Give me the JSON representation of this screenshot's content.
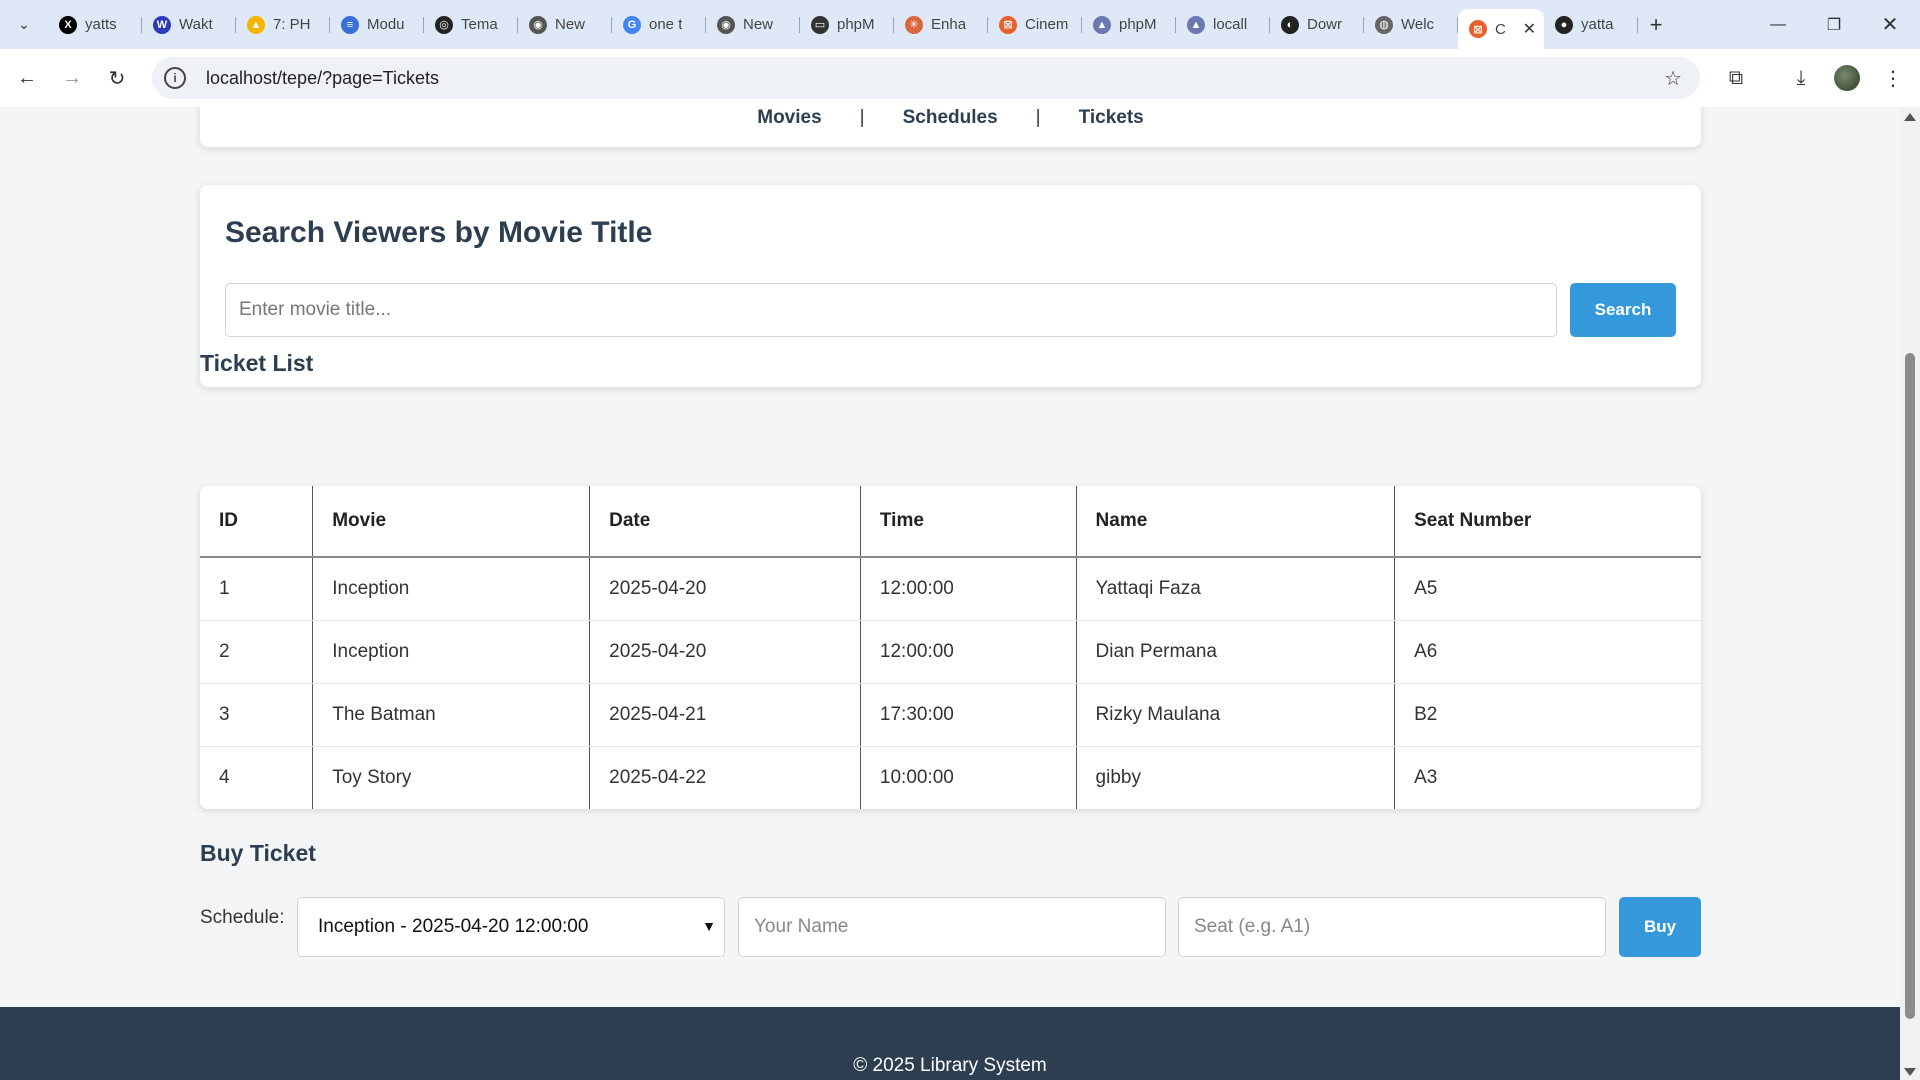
{
  "browser": {
    "tabs": [
      {
        "label": "yatts",
        "icon": "x-logo-icon",
        "color": "#000000",
        "glyph": "X"
      },
      {
        "label": "Wakt",
        "icon": "wakatime-icon",
        "color": "#2b3bb8",
        "glyph": "W"
      },
      {
        "label": "7: PH",
        "icon": "google-drive-icon",
        "color": "#f4b400",
        "glyph": "▲"
      },
      {
        "label": "Modu",
        "icon": "google-docs-icon",
        "color": "#3b6fd8",
        "glyph": "≡"
      },
      {
        "label": "Tema",
        "icon": "openai-icon",
        "color": "#222222",
        "glyph": "◎"
      },
      {
        "label": "New",
        "icon": "chrome-icon",
        "color": "#555555",
        "glyph": "◉"
      },
      {
        "label": "one t",
        "icon": "google-icon",
        "color": "#4285f4",
        "glyph": "G"
      },
      {
        "label": "New",
        "icon": "chrome-icon",
        "color": "#555555",
        "glyph": "◉"
      },
      {
        "label": "phpM",
        "icon": "laptop-icon",
        "color": "#333333",
        "glyph": "▭"
      },
      {
        "label": "Enha",
        "icon": "claude-icon",
        "color": "#d9663c",
        "glyph": "✳"
      },
      {
        "label": "Cinem",
        "icon": "xampp-icon",
        "color": "#e8602c",
        "glyph": "⊠"
      },
      {
        "label": "phpM",
        "icon": "phpmyadmin-icon",
        "color": "#6c78af",
        "glyph": "▲"
      },
      {
        "label": "locall",
        "icon": "phpmyadmin-icon",
        "color": "#6c78af",
        "glyph": "▲"
      },
      {
        "label": "Dowr",
        "icon": "download-site-icon",
        "color": "#222222",
        "glyph": "◐"
      },
      {
        "label": "Welc",
        "icon": "globe-icon",
        "color": "#666666",
        "glyph": "◍"
      },
      {
        "label": "C",
        "icon": "xampp-icon",
        "color": "#e8602c",
        "glyph": "⊠",
        "active": true
      },
      {
        "label": "yatta",
        "icon": "github-icon",
        "color": "#222222",
        "glyph": "●"
      }
    ],
    "url": "localhost/tepe/?page=Tickets"
  },
  "nav": {
    "links": [
      "Movies",
      "Schedules",
      "Tickets"
    ],
    "separator": "|"
  },
  "search": {
    "title": "Search Viewers by Movie Title",
    "placeholder": "Enter movie title...",
    "button": "Search"
  },
  "tickets": {
    "title": "Ticket List",
    "columns": [
      "ID",
      "Movie",
      "Date",
      "Time",
      "Name",
      "Seat Number"
    ],
    "rows": [
      [
        "1",
        "Inception",
        "2025-04-20",
        "12:00:00",
        "Yattaqi Faza",
        "A5"
      ],
      [
        "2",
        "Inception",
        "2025-04-20",
        "12:00:00",
        "Dian Permana",
        "A6"
      ],
      [
        "3",
        "The Batman",
        "2025-04-21",
        "17:30:00",
        "Rizky Maulana",
        "B2"
      ],
      [
        "4",
        "Toy Story",
        "2025-04-22",
        "10:00:00",
        "gibby",
        "A3"
      ]
    ]
  },
  "buy": {
    "title": "Buy Ticket",
    "schedule_label": "Schedule:",
    "schedule_selected": "Inception - 2025-04-20 12:00:00",
    "name_placeholder": "Your Name",
    "seat_placeholder": "Seat (e.g. A1)",
    "button": "Buy"
  },
  "footer": {
    "text": "© 2025 Library System"
  },
  "colors": {
    "accent": "#3498db",
    "heading": "#2c3e50",
    "footer_bg": "#2c3e50"
  }
}
